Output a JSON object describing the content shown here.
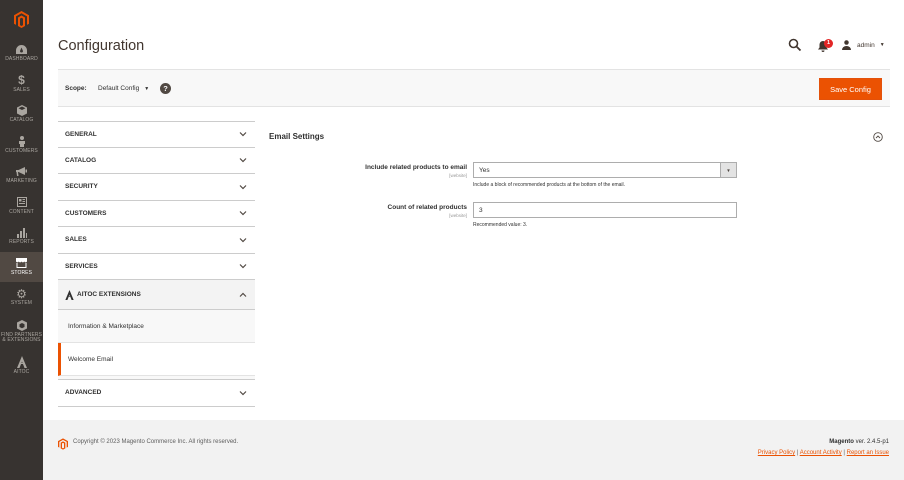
{
  "menu": {
    "items": [
      {
        "label": "Dashboard",
        "icon": "dashboard-icon"
      },
      {
        "label": "Sales",
        "icon": "dollar-icon"
      },
      {
        "label": "Catalog",
        "icon": "cube-icon"
      },
      {
        "label": "Customers",
        "icon": "person-icon"
      },
      {
        "label": "Marketing",
        "icon": "megaphone-icon"
      },
      {
        "label": "Content",
        "icon": "content-icon"
      },
      {
        "label": "Reports",
        "icon": "bar-chart-icon"
      },
      {
        "label": "Stores",
        "icon": "store-icon",
        "active": true
      },
      {
        "label": "System",
        "icon": "gear-icon"
      },
      {
        "label": "Find Partners & Extensions",
        "icon": "partners-icon"
      },
      {
        "label": "Aitoc",
        "icon": "aitoc-icon"
      }
    ]
  },
  "header": {
    "title": "Configuration",
    "notification_count": "1",
    "user": "admin"
  },
  "scope": {
    "label": "Scope:",
    "value": "Default Config",
    "help": "?",
    "save_label": "Save Config"
  },
  "nav": {
    "general": "GENERAL",
    "catalog": "CATALOG",
    "security": "SECURITY",
    "customers": "CUSTOMERS",
    "sales": "SALES",
    "services": "SERVICES",
    "aitoc": "AITOC EXTENSIONS",
    "aitoc_items": [
      "Information & Marketplace",
      "Welcome Email"
    ],
    "advanced": "ADVANCED"
  },
  "settings": {
    "title": "Email Settings",
    "fields": [
      {
        "label": "Include related products to email",
        "scope": "[website]",
        "value": "Yes",
        "note": "Include a block of recommended products at the bottom of the email."
      },
      {
        "label": "Count of related products",
        "scope": "[website]",
        "value": "3",
        "note": "Recommended value: 3."
      }
    ]
  },
  "footer": {
    "copyright": "Copyright © 2023 Magento Commerce Inc. All rights reserved.",
    "brand": "Magento",
    "version": " ver. 2.4.5-p1",
    "links": [
      "Privacy Policy",
      "Account Activity",
      "Report an Issue"
    ],
    "separator": " | "
  },
  "colors": {
    "accent": "#eb5202",
    "menu_bg": "#373330",
    "menu_active": "#514943"
  }
}
